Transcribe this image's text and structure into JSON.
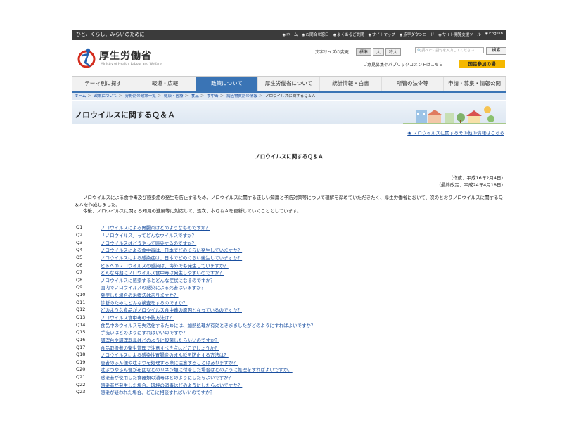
{
  "topbar": {
    "tagline": "ひと、くらし、みらいのために",
    "links": [
      "ホーム",
      "お問合せ窓口",
      "よくあるご質問",
      "サイトマップ",
      "点字ダウンロード",
      "サイト閲覧支援ツール",
      "English"
    ]
  },
  "header": {
    "logo_text": "厚生労働省",
    "logo_sub": "Ministry of Health, Labour and Welfare",
    "font_size_label": "文字サイズの変更",
    "font_sizes": [
      "標準",
      "大",
      "特大"
    ],
    "search_placeholder": "調べたい語句を入力してください",
    "search_button": "検索",
    "pubcom": "ご意見募集やパブリックコメントはこちら",
    "kokumin": "国民参加の場"
  },
  "nav": {
    "items": [
      "テーマ別に探す",
      "報道・広報",
      "政策について",
      "厚生労働省について",
      "統計情報・白書",
      "所管の法令等",
      "申請・募集・情報公開"
    ],
    "active_index": 2
  },
  "breadcrumb": {
    "links": [
      "ホーム",
      "政策について",
      "分野別の政策一覧",
      "健康・医療",
      "食品",
      "食中毒",
      "病因物質別の情報"
    ],
    "current": "ノロウイルスに関するＱ＆Ａ"
  },
  "page": {
    "title": "ノロウイルスに関するＱ＆Ａ",
    "more_link": "ノロウイルスに関するその他の情報はこちら",
    "heading": "ノロウイルスに関するＱ＆Ａ",
    "date_created": "（作成：平成16年2月4日）",
    "date_revised": "（最終改定：平成24年4月18日）",
    "intro_1": "ノロウイルスによる食中毒及び感染症の発生を防止するため、ノロウイルスに関する正しい知識と予防対策等について理解を深めていただきたく、厚生労働省において、次のとおりノロウイルスに関するＱ＆Ａを作成しました。",
    "intro_2": "今後、ノロウイルスに関する知見の進展等に対応して、逐次、本Ｑ＆Ａを更新していくこととしています。"
  },
  "questions": [
    {
      "num": "Q1",
      "text": "ノロウイルスによる胃腸炎はどのようなものですか？"
    },
    {
      "num": "Q2",
      "text": "「ノロウイルス」ってどんなウイルスですか？"
    },
    {
      "num": "Q3",
      "text": "ノロウイルスはどうやって感染するのですか？"
    },
    {
      "num": "Q4",
      "text": "ノロウイルスによる食中毒は、日本でどのくらい発生していますか？"
    },
    {
      "num": "Q5",
      "text": "ノロウイルスによる感染症は、日本でどのくらい発生していますか？"
    },
    {
      "num": "Q6",
      "text": "ヒトへのノロウイルスの感染は、海外でも発生していますか？"
    },
    {
      "num": "Q7",
      "text": "どんな時期にノロウイルス食中毒は発生しやすいのですか？"
    },
    {
      "num": "Q8",
      "text": "ノロウイルスに感染するとどんな症状になるのですか？"
    },
    {
      "num": "Q9",
      "text": "国内でノロウイルスの感染による死者はいますか？"
    },
    {
      "num": "Q10",
      "text": "発症した場合の治療法はありますか？"
    },
    {
      "num": "Q11",
      "text": "診断のためにどんな検査をするのですか？"
    },
    {
      "num": "Q12",
      "text": "どのような食品がノロウイルス食中毒の原因となっているのですか？"
    },
    {
      "num": "Q13",
      "text": "ノロウイルス食中毒の予防方法は？"
    },
    {
      "num": "Q14",
      "text": "食品中のウイルスを失活化するためには、加熱処理が有効ときまましたがどのようにすればよいですか？"
    },
    {
      "num": "Q15",
      "text": "手洗いはどのようにすればいいのですか？"
    },
    {
      "num": "Q16",
      "text": "調理台や調理器具はどのように殺菌したらいいのですか？"
    },
    {
      "num": "Q17",
      "text": "食品取扱者の衛生管理で注意すべき点はどこでしょうか？"
    },
    {
      "num": "Q18",
      "text": "ノロウイルスによる感染性胃腸炎のまん延を防止する方法は？"
    },
    {
      "num": "Q19",
      "text": "患者のふん便や吐ぶつを処理する際に注意することはありますか？"
    },
    {
      "num": "Q20",
      "text": "吐ぶつやふん便が布団などのリネン類に付着した場合はどのように処理をすればよいですか。"
    },
    {
      "num": "Q21",
      "text": "感染者が使用した食器類の消毒はどのようにしたらよいですか？"
    },
    {
      "num": "Q22",
      "text": "感染者が発生した場合、環境の消毒はどのようにしたらよいですか？"
    },
    {
      "num": "Q23",
      "text": "感染が疑われた場合、どこに相談すればいいのですか？"
    }
  ],
  "colors": {
    "nav_active": "#3a74b5",
    "link": "#1a4fa0",
    "kokumin": "#f5b800"
  }
}
